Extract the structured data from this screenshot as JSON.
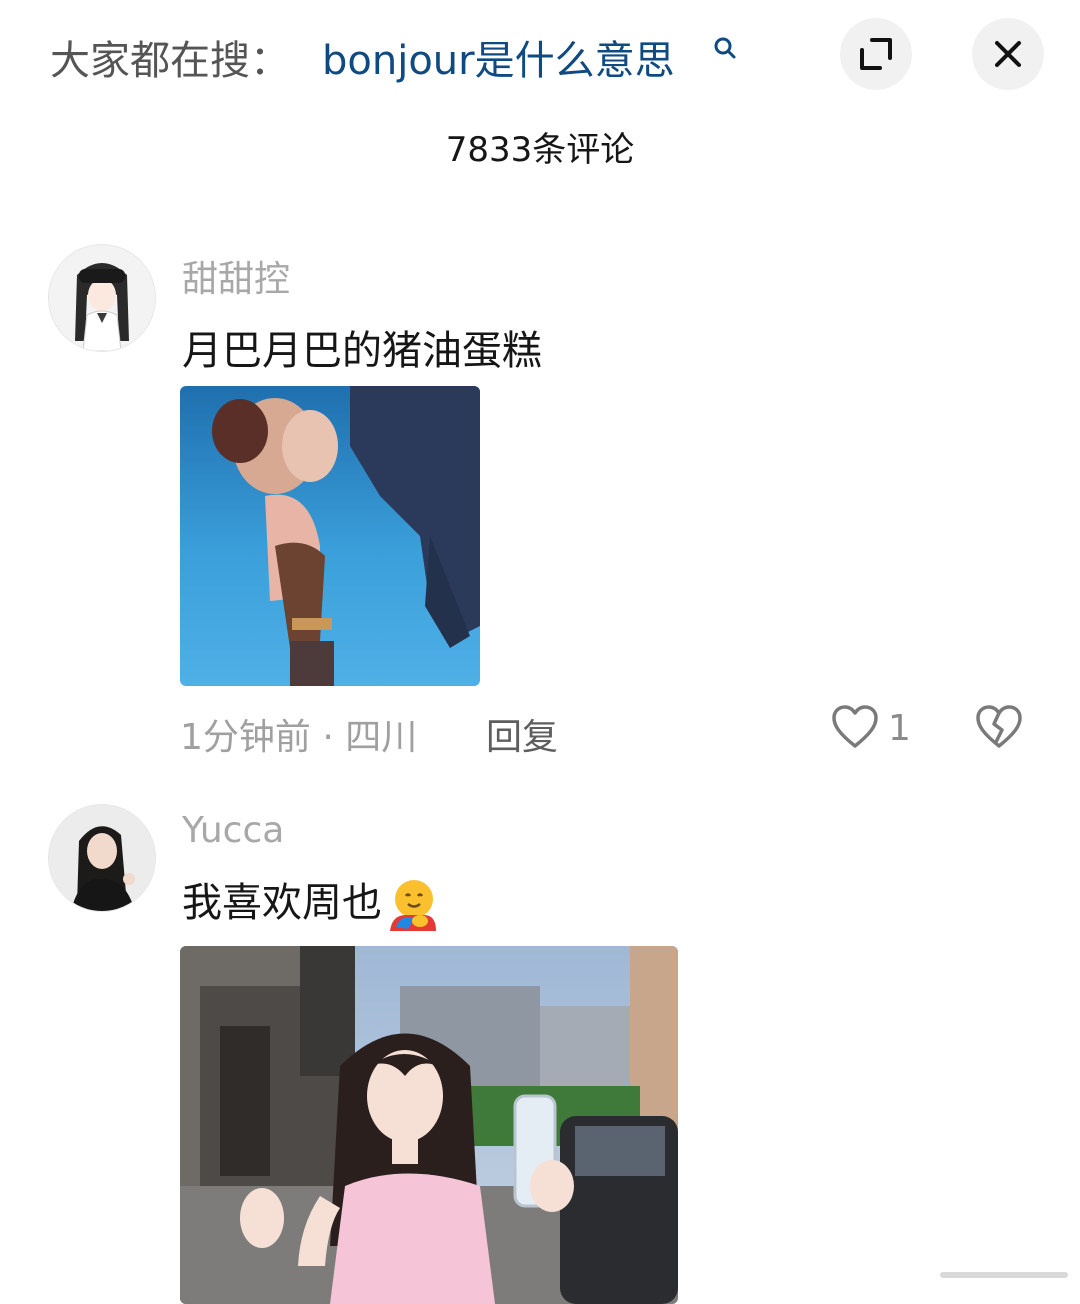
{
  "header": {
    "search_prefix": "大家都在搜：",
    "search_query": "bonjour是什么意思",
    "search_icon": "search-icon",
    "expand_icon": "expand-icon",
    "close_icon": "close-icon"
  },
  "comment_count": "7833条评论",
  "comments": [
    {
      "username": "甜甜控",
      "text": "月巴月巴的猪油蛋糕",
      "time_location": "1分钟前 · 四川",
      "reply_label": "回复",
      "like_count": "1",
      "image": "animated-character-meme"
    },
    {
      "username": "Yucca",
      "text": "我喜欢周也",
      "emoji": "hugging-face-emoji",
      "image": "woman-holding-water-bottle-photo"
    }
  ],
  "colors": {
    "link_blue": "#0f4a82",
    "meta_gray": "#a0a0a0",
    "button_bg": "#f1f1f1"
  }
}
